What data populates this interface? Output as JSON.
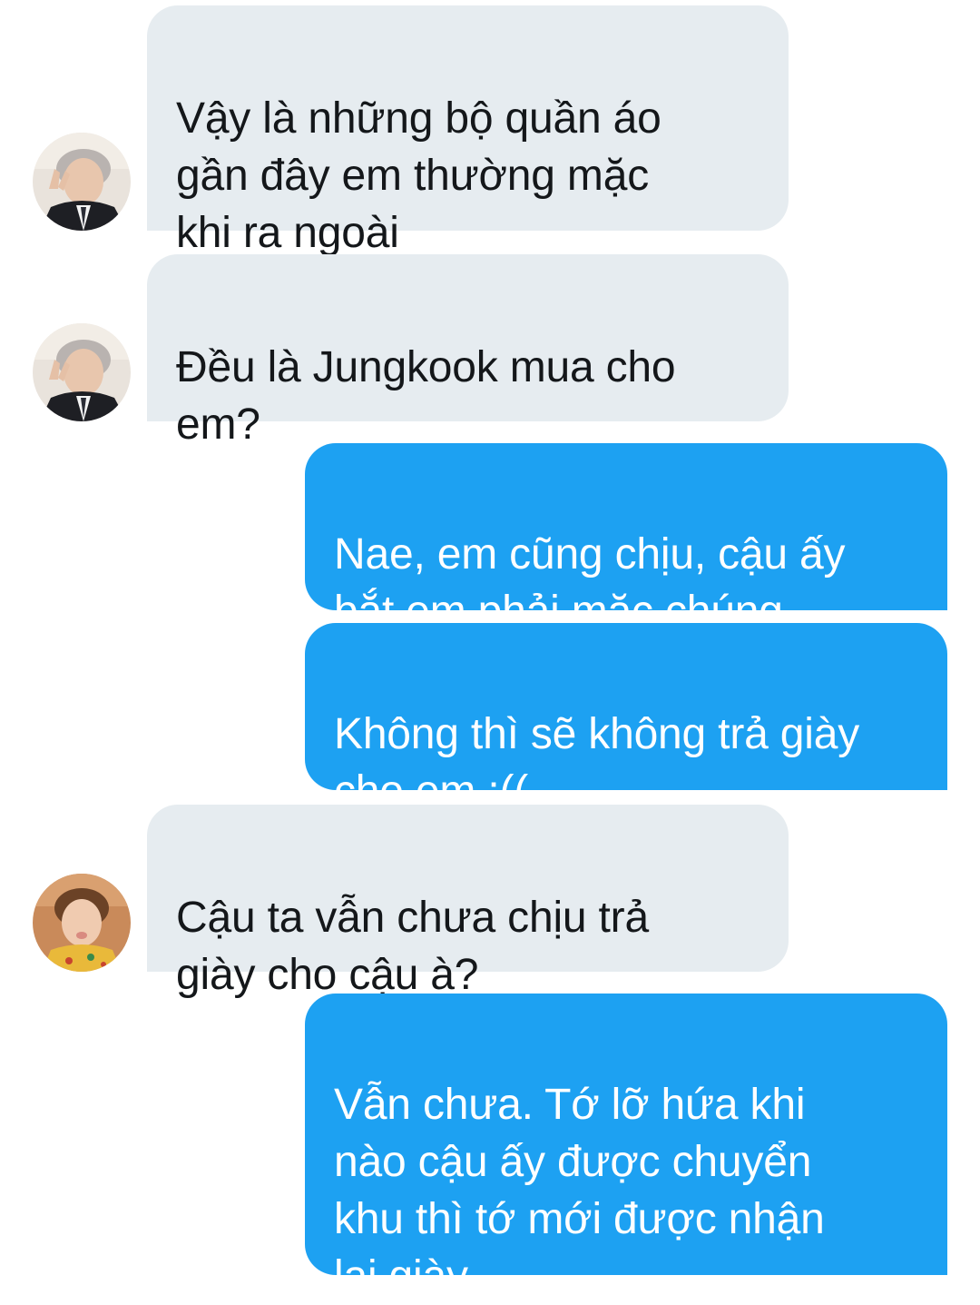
{
  "conversation": {
    "messages": [
      {
        "direction": "incoming",
        "avatar": "avatar-gray-hair-peace-sign",
        "text": "Vậy là những bộ quần áo\ngần đây em thường mặc\nkhi ra ngoài"
      },
      {
        "direction": "incoming",
        "avatar": "avatar-gray-hair-peace-sign",
        "text": "Đều là Jungkook mua cho\nem?"
      },
      {
        "direction": "outgoing",
        "text": "Nae, em cũng chịu, cậu ấy\nbắt em phải mặc chúng"
      },
      {
        "direction": "outgoing",
        "text": "Không thì sẽ không trả giày\ncho em :(("
      },
      {
        "direction": "incoming",
        "avatar": "avatar-brown-hair-yellow-shirt",
        "text": "Cậu ta vẫn chưa chịu trả\ngiày cho cậu à?"
      },
      {
        "direction": "outgoing",
        "text": "Vẫn chưa. Tớ lỡ hứa khi\nnào cậu ấy được chuyển\nkhu thì tớ mới được nhận\nlại giày"
      }
    ]
  },
  "colors": {
    "incoming_bubble": "#e6ecf0",
    "incoming_text": "#14171a",
    "outgoing_bubble": "#1da1f2",
    "outgoing_text": "#ffffff"
  }
}
